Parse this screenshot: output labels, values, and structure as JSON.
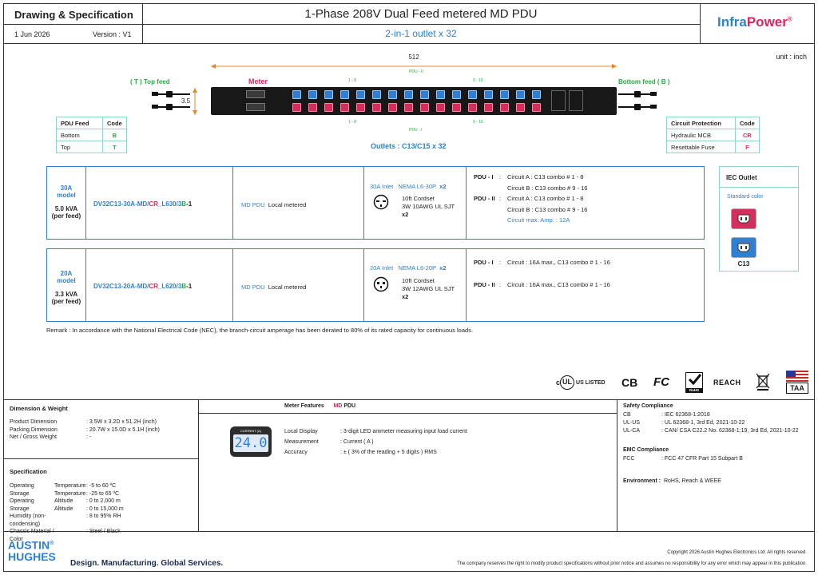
{
  "header": {
    "doc_type": "Drawing & Specification",
    "date": "1 Jun 2026",
    "version": "Version : V1",
    "title": "1-Phase 208V Dual Feed metered MD PDU",
    "subtitle": "2-in-1 outlet x 32",
    "brand_prefix": "Infra",
    "brand_suffix": "Power",
    "brand_reg": "®"
  },
  "drawing": {
    "unit": "unit : inch",
    "width_dim": "512",
    "height_dim": "3.5",
    "top_feed": "( T ) Top feed",
    "bottom_feed": "Bottom feed ( B )",
    "meter_label": "Meter",
    "pdu_ii": "PDU - II",
    "pdu_i": "PDU - I",
    "group_1_8": "1 - 8",
    "group_9_16": "9 - 16",
    "outlets": "Outlets : C13/C15 x 32"
  },
  "feed_table": {
    "headers": [
      "PDU Feed",
      "Code"
    ],
    "rows": [
      [
        "Bottom",
        "B"
      ],
      [
        "Top",
        "T"
      ]
    ]
  },
  "protection_table": {
    "headers": [
      "Circuit Protection",
      "Code"
    ],
    "rows": [
      [
        "Hydraulic MCB",
        "CR"
      ],
      [
        "Resettable Fuse",
        "F"
      ]
    ]
  },
  "models": [
    {
      "amp": "30A",
      "model_word": "model",
      "kva": "5.0 kVA",
      "per_feed": "(per feed)",
      "pn_a": "DV32C13-30A-MD/",
      "pn_b": "CR",
      "pn_c": "_L630/3",
      "pn_d": "B",
      "pn_e": "-1",
      "type": "MD PDU",
      "type_desc": "Local metered",
      "inlet": "30A Inlet",
      "plug": "NEMA L6-30P",
      "plug_qty": "x2",
      "cord1": "10ft Cordset",
      "cord2": "3W 10AWG UL SJT",
      "cord_qty": "x2",
      "circuits": [
        {
          "pdu": "PDU - I",
          "sep": ":",
          "text": "Circuit A  :  C13 combo # 1 - 8"
        },
        {
          "pdu": "",
          "sep": "",
          "text": "Circuit B  :  C13 combo # 9 - 16"
        },
        {
          "pdu": "PDU - II",
          "sep": ":",
          "text": "Circuit A  :  C13 combo # 1 - 8"
        },
        {
          "pdu": "",
          "sep": "",
          "text": "Circuit B  :  C13 combo # 9 - 16"
        }
      ],
      "max_amp": "Circuit max. Amp.  :  12A"
    },
    {
      "amp": "20A",
      "model_word": "model",
      "kva": "3.3 kVA",
      "per_feed": "(per feed)",
      "pn_a": "DV32C13-20A-MD/",
      "pn_b": "CR",
      "pn_c": "_L620/3",
      "pn_d": "B",
      "pn_e": "-1",
      "type": "MD PDU",
      "type_desc": "Local metered",
      "inlet": "20A Inlet",
      "plug": "NEMA L6-20P",
      "plug_qty": "x2",
      "cord1": "10ft Cordset",
      "cord2": "3W 12AWG UL SJT",
      "cord_qty": "x2",
      "circuits": [
        {
          "pdu": "PDU - I",
          "sep": ":",
          "text": "Circuit  :  16A max., C13 combo # 1 - 16"
        },
        {
          "pdu": "PDU - II",
          "sep": ":",
          "text": "Circuit  :  16A max., C13 combo # 1 - 16"
        }
      ]
    }
  ],
  "iec": {
    "title": "IEC Outlet",
    "std_color": "Standard color",
    "label": "C13"
  },
  "remark": "Remark : In accordance with the National Electrical Code (NEC), the branch-circuit amperage has been derated to 80% of its rated capacity for continuous loads.",
  "certs": {
    "ul": "US LISTED",
    "ce": "CB",
    "fc": "FC",
    "rohs": "RoHS",
    "reach": "REACH",
    "taa": "TAA"
  },
  "dimension": {
    "title": "Dimension & Weight",
    "rows": [
      [
        "Product Dimension",
        ":  3.5W x 3.2D x 51.2H (inch)"
      ],
      [
        "Packing Dimension",
        ":  20.7W x 15.0D x 5.1H (inch)"
      ],
      [
        "Net / Gross Weight",
        ":  -"
      ]
    ]
  },
  "specification": {
    "title": "Specification",
    "rows": [
      [
        "Operating",
        "Temperature",
        ":  -5 to 60 ºC"
      ],
      [
        "Storage",
        "Temperature",
        ":  -25 to 65 ºC"
      ],
      [
        "Operating",
        "Altitude",
        ":  0 to 2,000 m"
      ],
      [
        "Storage",
        "Altitude",
        ":  0 to 15,000 m"
      ],
      [
        "Humidity (non-condensing)",
        "",
        ":  8 to 95% RH"
      ],
      [
        "Chassis Material / Color",
        "",
        ":  Steel / Black"
      ]
    ]
  },
  "meter": {
    "title": "Meter Features",
    "model": "MD",
    "model2": "PDU",
    "display_label": "CURRENT (A)",
    "display_value": "24.0",
    "rows": [
      [
        "Local Display",
        ":  3-digit LED ammeter measuring input load current"
      ],
      [
        "Measurement",
        ":  Current ( A )"
      ],
      [
        "Accuracy",
        ":  ± ( 3% of the reading + 5 digits ) RMS"
      ]
    ]
  },
  "safety": {
    "title": "Safety Compliance",
    "rows": [
      [
        "CB",
        ":  IEC 62368-1:2018"
      ],
      [
        "UL-US",
        ":  UL 62368-1, 3rd Ed, 2021-10-22"
      ],
      [
        "UL-CA",
        ":  CAN/ CSA C22.2 No. 62368-1:19, 3rd Ed, 2021-10-22"
      ]
    ],
    "emc_title": "EMC Compliance",
    "emc_rows": [
      [
        "FCC",
        ":  FCC 47 CFR Part 15 Subpart B"
      ]
    ],
    "env_label": "Environment  :",
    "env_value": "RoHS, Reach & WEEE"
  },
  "footer": {
    "logo_line1": "AUSTIN",
    "logo_line2": "HUGHES",
    "logo_reg": "®",
    "tagline": "Design. Manufacturing. Global Services.",
    "copyright": "Copyright 2026 Austin Hughes Electronics Ltd. All rights reserved.",
    "disclaimer": "The company reserves the right to modify product specifications without prior notice and assumes no responsibility for any error which may appear in this publication."
  },
  "colors": {
    "accent_blue": "#2f7fd3",
    "accent_red": "#e0245e",
    "accent_green": "#27a845",
    "orange": "#e8862a"
  }
}
